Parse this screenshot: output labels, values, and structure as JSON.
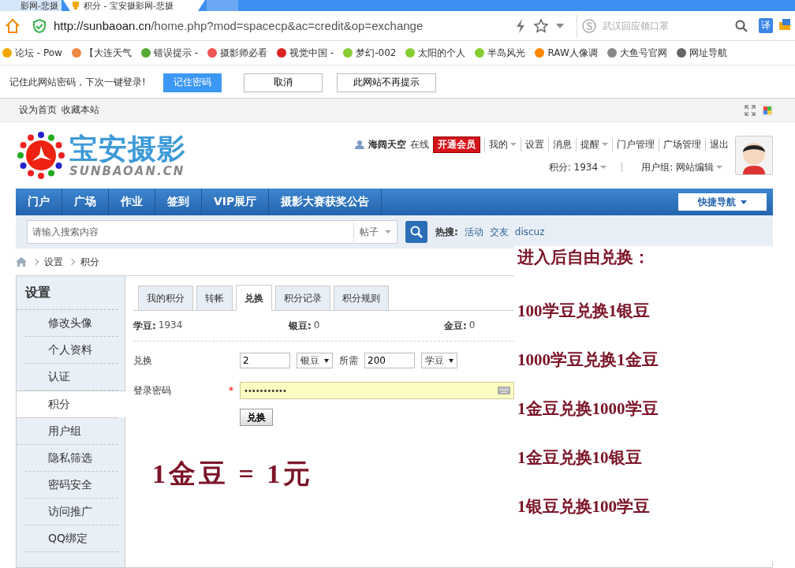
{
  "browser": {
    "tabs": [
      {
        "title": "影网-悲摄",
        "selected": false
      },
      {
        "title": "积分 - 宝安摄影网-悲摄",
        "selected": true
      }
    ],
    "url_host": "http://sunbaoan.cn",
    "url_path": "/home.php?mod=spacecp&ac=credit&op=exchange",
    "search_placeholder": "武汉回应领口罩",
    "translate": "译",
    "bookmarks": [
      "论坛 - Pow",
      "【大连天气",
      "错误提示 -",
      "摄影师必看",
      "视觉中国 -",
      "梦幻-002",
      "太阳的个人",
      "半岛风光",
      "RAW人像调",
      "大鱼号官网",
      "网址导航"
    ]
  },
  "password_prompt": {
    "message": "记住此网站密码，下次一键登录!",
    "buttons": [
      "记住密码",
      "取消",
      "此网站不再提示"
    ]
  },
  "site_links": [
    "设为首页",
    "收藏本站"
  ],
  "logo": {
    "title": "宝安摄影",
    "subtitle": "SUNBAOAN.CN"
  },
  "user": {
    "name": "海阔天空",
    "status": "在线",
    "vip": "开通会员",
    "links": [
      {
        "label": "我的",
        "dropdown": true
      },
      {
        "label": "设置",
        "dropdown": false
      },
      {
        "label": "消息",
        "dropdown": false
      },
      {
        "label": "提醒",
        "dropdown": true
      },
      {
        "label": "门户管理",
        "dropdown": false
      },
      {
        "label": "广场管理",
        "dropdown": false
      },
      {
        "label": "退出",
        "dropdown": false
      }
    ],
    "points": "积分: 1934",
    "group": "用户组: 网站编辑"
  },
  "nav": {
    "items": [
      "门户",
      "广场",
      "作业",
      "签到",
      "VIP展厅",
      "摄影大赛获奖公告"
    ],
    "quick": "快捷导航"
  },
  "search": {
    "placeholder": "请输入搜索内容",
    "type": "帖子",
    "hot_label": "热搜:",
    "hot": [
      "活动",
      "交友",
      "discuz"
    ]
  },
  "breadcrumb": [
    "设置",
    "积分"
  ],
  "sidebar": {
    "title": "设置",
    "items": [
      {
        "label": "修改头像",
        "selected": false
      },
      {
        "label": "个人资料",
        "selected": false
      },
      {
        "label": "认证",
        "selected": false
      },
      {
        "label": "积分",
        "selected": true
      },
      {
        "label": "用户组",
        "selected": false
      },
      {
        "label": "隐私筛选",
        "selected": false
      },
      {
        "label": "密码安全",
        "selected": false
      },
      {
        "label": "访问推广",
        "selected": false
      },
      {
        "label": "QQ绑定",
        "selected": false
      }
    ]
  },
  "tabs": [
    {
      "label": "我的积分",
      "selected": false
    },
    {
      "label": "转帐",
      "selected": false
    },
    {
      "label": "兑换",
      "selected": true
    },
    {
      "label": "积分记录",
      "selected": false
    },
    {
      "label": "积分规则",
      "selected": false
    }
  ],
  "balances": [
    {
      "label": "学豆:",
      "value": "1934"
    },
    {
      "label": "银豆:",
      "value": "0"
    },
    {
      "label": "金豆:",
      "value": "0"
    }
  ],
  "form": {
    "exchange_label": "兑换",
    "amount": "2",
    "unit": "银豆",
    "need_label": "所需",
    "cost": "200",
    "cost_unit": "学豆",
    "password_label": "登录密码",
    "required_mark": "*",
    "password": "•••••••••••",
    "submit": "兑换"
  },
  "annotations": {
    "heading": "进入后自由兑换：",
    "lines": [
      "100学豆兑换1银豆",
      "1000学豆兑换1金豆",
      "1金豆兑换1000学豆",
      "1金豆兑换10银豆",
      "1银豆兑换100学豆"
    ],
    "equation": "1金豆 = 1元"
  }
}
